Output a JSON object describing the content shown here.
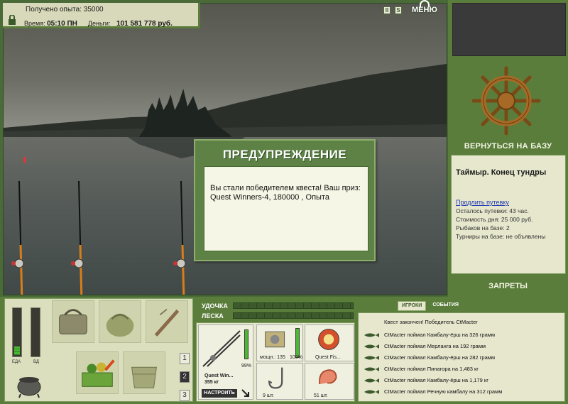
{
  "info": {
    "exp_label": "Получено опыта:",
    "exp_value": "35000",
    "time_label": "Время:",
    "time_value": "05:10 ПН",
    "money_label": "Деньги:",
    "money_value": "101 581 778 руб."
  },
  "top": {
    "btn1": "II",
    "btn2": "S",
    "menu": "МЕНЮ"
  },
  "right": {
    "return_button": "ВЕРНУТЬСЯ НА БАЗУ",
    "location_title": "Таймыр. Конец тундры",
    "extend_link": "Продлить путевку",
    "stats": [
      "Осталось путевки: 43 час.",
      "Стоимость дня: 25 000 руб.",
      "Рыбаков на базе: 2",
      "Турниры на базе: не объявлены"
    ],
    "rules_button": "ЗАПРЕТЫ"
  },
  "dialog": {
    "title": "ПРЕДУПРЕЖДЕНИЕ",
    "message": "Вы стали победителем квеста! Ваш приз: Quest Winners-4, 180000 , Опыта"
  },
  "gauges": {
    "food_label": "ЕДА",
    "food_level": 0.18,
    "alco_label": "ВД",
    "alco_level": 0.0
  },
  "tabs_num": [
    "1",
    "2",
    "3"
  ],
  "tackle": {
    "rod_label": "УДОЧКА",
    "line_label": "ЛЕСКА",
    "rod_name": "Quest Win...",
    "rod_weight": "355 кг",
    "rod_percent": "99%",
    "reel_power": "мощн.: 135",
    "reel_percent": "100%",
    "line_name": "Quest Fis...",
    "hook_count": "9 шт.",
    "bait_count": "51 шт.",
    "setup_button": "НАСТРОИТЬ"
  },
  "log": {
    "tab_players": "ИГРОКИ",
    "tab_events": "СОБЫТИЯ",
    "header": "Квест закончен! Победитель CtMacter",
    "lines": [
      "CtMacter поймал Камбалу-ёрш на 326 грамм",
      "CtMacter поймал Мерланга на 192 грамм",
      "CtMacter поймал Камбалу-ёрш на 282 грамм",
      "CtMacter поймал Пинагора на 1,483 кг",
      "CtMacter поймал Камбалу-ёрш на 1,179 кг",
      "CtMacter поймал Речную камбалу на 312 грамм"
    ]
  }
}
